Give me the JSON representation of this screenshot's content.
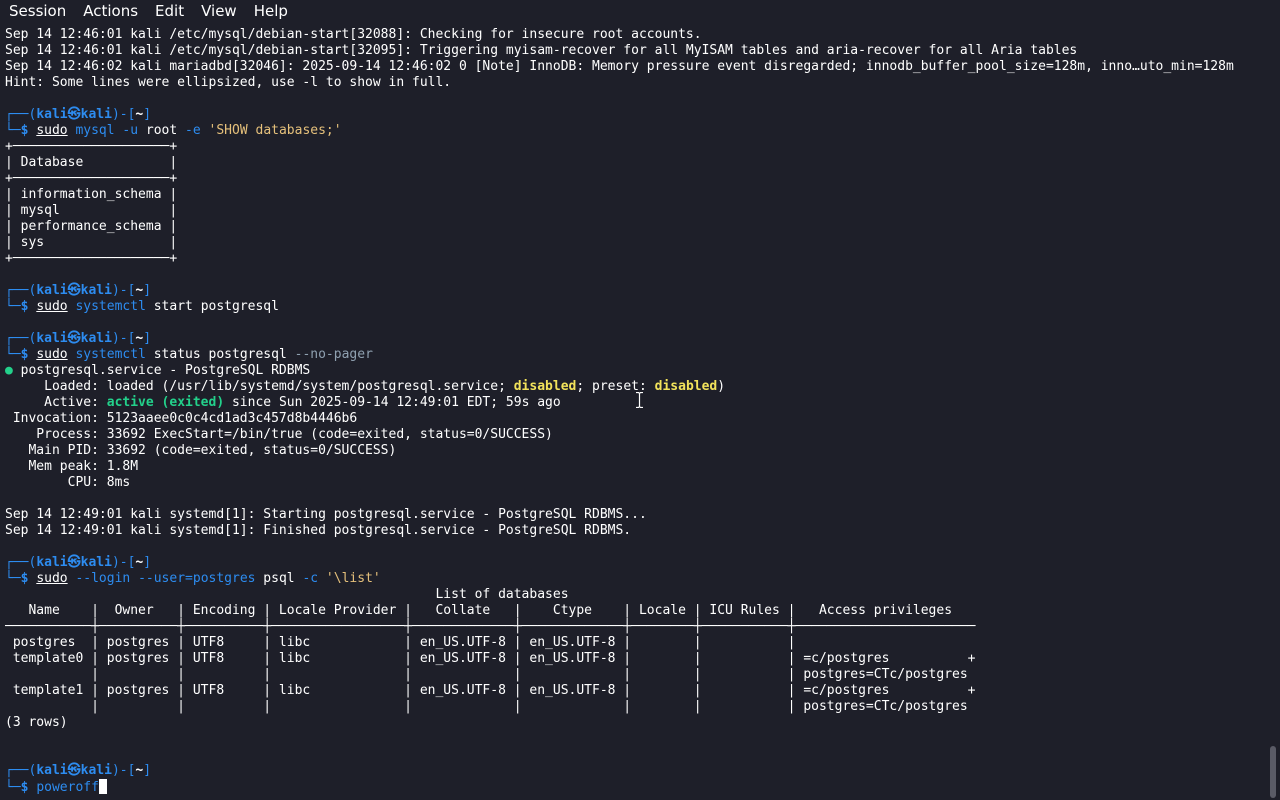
{
  "menubar": {
    "items": [
      "Session",
      "Actions",
      "Edit",
      "View",
      "Help"
    ]
  },
  "colors": {
    "background": "#1e1f29",
    "prompt_blue": "#2d8cf0",
    "ok_green": "#23d18b",
    "warn_yellow": "#f2e35b",
    "string_orange": "#e5c07b"
  },
  "terminal": {
    "lines": [
      [
        {
          "t": "Sep 14 12:46:01 kali /etc/mysql/debian-start[32088]: Checking for insecure root accounts.",
          "c": "default"
        }
      ],
      [
        {
          "t": "Sep 14 12:46:01 kali /etc/mysql/debian-start[32095]: Triggering myisam-recover for all MyISAM tables and aria-recover for all Aria tables",
          "c": "default"
        }
      ],
      [
        {
          "t": "Sep 14 12:46:02 kali mariadbd[32046]: 2025-09-14 12:46:02 0 [Note] InnoDB: Memory pressure event disregarded; innodb_buffer_pool_size=128m, inno…uto_min=128m",
          "c": "default"
        }
      ],
      [
        {
          "t": "Hint: Some lines were ellipsized, use -l to show in full.",
          "c": "default"
        }
      ],
      [
        {
          "t": "",
          "c": "default"
        }
      ],
      [
        {
          "t": "┌──(",
          "c": "prompt"
        },
        {
          "t": "kali㉿kali",
          "c": "user"
        },
        {
          "t": ")-[",
          "c": "prompt"
        },
        {
          "t": "~",
          "c": "path"
        },
        {
          "t": "]",
          "c": "prompt"
        }
      ],
      [
        {
          "t": "└─",
          "c": "prompt"
        },
        {
          "t": "$ ",
          "c": "dollar"
        },
        {
          "t": "sudo",
          "c": "cmd-sudo-plain"
        },
        {
          "t": " mysql",
          "c": "cmd"
        },
        {
          "t": " -u",
          "c": "flag"
        },
        {
          "t": " root",
          "c": "arg"
        },
        {
          "t": " -e",
          "c": "flag"
        },
        {
          "t": " 'SHOW databases;'",
          "c": "str"
        }
      ],
      [
        {
          "t": "+────────────────────+",
          "c": "default"
        }
      ],
      [
        {
          "t": "| Database           |",
          "c": "default"
        }
      ],
      [
        {
          "t": "+────────────────────+",
          "c": "default"
        }
      ],
      [
        {
          "t": "| information_schema |",
          "c": "default"
        }
      ],
      [
        {
          "t": "| mysql              |",
          "c": "default"
        }
      ],
      [
        {
          "t": "| performance_schema |",
          "c": "default"
        }
      ],
      [
        {
          "t": "| sys                |",
          "c": "default"
        }
      ],
      [
        {
          "t": "+────────────────────+",
          "c": "default"
        }
      ],
      [
        {
          "t": "",
          "c": "default"
        }
      ],
      [
        {
          "t": "┌──(",
          "c": "prompt"
        },
        {
          "t": "kali㉿kali",
          "c": "user"
        },
        {
          "t": ")-[",
          "c": "prompt"
        },
        {
          "t": "~",
          "c": "path"
        },
        {
          "t": "]",
          "c": "prompt"
        }
      ],
      [
        {
          "t": "└─",
          "c": "prompt"
        },
        {
          "t": "$ ",
          "c": "dollar"
        },
        {
          "t": "sudo",
          "c": "cmd-sudo-plain"
        },
        {
          "t": " systemctl",
          "c": "cmd"
        },
        {
          "t": " start postgresql",
          "c": "arg"
        }
      ],
      [
        {
          "t": "",
          "c": "default"
        }
      ],
      [
        {
          "t": "┌──(",
          "c": "prompt"
        },
        {
          "t": "kali㉿kali",
          "c": "user"
        },
        {
          "t": ")-[",
          "c": "prompt"
        },
        {
          "t": "~",
          "c": "path"
        },
        {
          "t": "]",
          "c": "prompt"
        }
      ],
      [
        {
          "t": "└─",
          "c": "prompt"
        },
        {
          "t": "$ ",
          "c": "dollar"
        },
        {
          "t": "sudo",
          "c": "cmd-sudo-plain"
        },
        {
          "t": " systemctl",
          "c": "cmd"
        },
        {
          "t": " status postgresql",
          "c": "arg"
        },
        {
          "t": " --no-pager",
          "c": "opt"
        }
      ],
      [
        {
          "t": "●",
          "c": "dot"
        },
        {
          "t": " postgresql.service - PostgreSQL RDBMS",
          "c": "default"
        }
      ],
      [
        {
          "t": "     Loaded: loaded (/usr/lib/systemd/system/postgresql.service; ",
          "c": "default"
        },
        {
          "t": "disabled",
          "c": "warn"
        },
        {
          "t": "; preset: ",
          "c": "default"
        },
        {
          "t": "disabled",
          "c": "warn"
        },
        {
          "t": ")",
          "c": "default"
        }
      ],
      [
        {
          "t": "     Active: ",
          "c": "default"
        },
        {
          "t": "active (exited)",
          "c": "ok"
        },
        {
          "t": " since Sun 2025-09-14 12:49:01 EDT; 59s ago",
          "c": "default"
        }
      ],
      [
        {
          "t": " Invocation: 5123aaee0c0c4cd1ad3c457d8b4446b6",
          "c": "default"
        }
      ],
      [
        {
          "t": "    Process: 33692 ExecStart=/bin/true (code=exited, status=0/SUCCESS)",
          "c": "default"
        }
      ],
      [
        {
          "t": "   Main PID: 33692 (code=exited, status=0/SUCCESS)",
          "c": "default"
        }
      ],
      [
        {
          "t": "   Mem peak: 1.8M",
          "c": "default"
        }
      ],
      [
        {
          "t": "        CPU: 8ms",
          "c": "default"
        }
      ],
      [
        {
          "t": "",
          "c": "default"
        }
      ],
      [
        {
          "t": "Sep 14 12:49:01 kali systemd[1]: Starting postgresql.service - PostgreSQL RDBMS...",
          "c": "default"
        }
      ],
      [
        {
          "t": "Sep 14 12:49:01 kali systemd[1]: Finished postgresql.service - PostgreSQL RDBMS.",
          "c": "default"
        }
      ],
      [
        {
          "t": "",
          "c": "default"
        }
      ],
      [
        {
          "t": "┌──(",
          "c": "prompt"
        },
        {
          "t": "kali㉿kali",
          "c": "user"
        },
        {
          "t": ")-[",
          "c": "prompt"
        },
        {
          "t": "~",
          "c": "path"
        },
        {
          "t": "]",
          "c": "prompt"
        }
      ],
      [
        {
          "t": "└─",
          "c": "prompt"
        },
        {
          "t": "$ ",
          "c": "dollar"
        },
        {
          "t": "sudo",
          "c": "cmd-sudo-plain"
        },
        {
          "t": " --login",
          "c": "flag"
        },
        {
          "t": " --user=postgres",
          "c": "flag"
        },
        {
          "t": " psql",
          "c": "arg"
        },
        {
          "t": " -c",
          "c": "flag"
        },
        {
          "t": " '\\list'",
          "c": "str"
        }
      ],
      [
        {
          "t": "                                                       List of databases",
          "c": "default"
        }
      ],
      [
        {
          "t": "   Name    |  Owner   | Encoding | Locale Provider |   Collate   |    Ctype    | Locale | ICU Rules |   Access privileges",
          "c": "default"
        }
      ],
      [
        {
          "t": "───────────┼──────────┼──────────┼─────────────────┼─────────────┼─────────────┼────────┼───────────┼───────────────────────",
          "c": "default"
        }
      ],
      [
        {
          "t": " postgres  | postgres | UTF8     | libc            | en_US.UTF-8 | en_US.UTF-8 |        |           |",
          "c": "default"
        }
      ],
      [
        {
          "t": " template0 | postgres | UTF8     | libc            | en_US.UTF-8 | en_US.UTF-8 |        |           | =c/postgres          +",
          "c": "default"
        }
      ],
      [
        {
          "t": "           |          |          |                 |             |             |        |           | postgres=CTc/postgres",
          "c": "default"
        }
      ],
      [
        {
          "t": " template1 | postgres | UTF8     | libc            | en_US.UTF-8 | en_US.UTF-8 |        |           | =c/postgres          +",
          "c": "default"
        }
      ],
      [
        {
          "t": "           |          |          |                 |             |             |        |           | postgres=CTc/postgres",
          "c": "default"
        }
      ],
      [
        {
          "t": "(3 rows)",
          "c": "default"
        }
      ],
      [
        {
          "t": "",
          "c": "default"
        }
      ],
      [
        {
          "t": "",
          "c": "default"
        }
      ],
      [
        {
          "t": "┌──(",
          "c": "prompt"
        },
        {
          "t": "kali㉿kali",
          "c": "user"
        },
        {
          "t": ")-[",
          "c": "prompt"
        },
        {
          "t": "~",
          "c": "path"
        },
        {
          "t": "]",
          "c": "prompt"
        }
      ],
      [
        {
          "t": "└─",
          "c": "prompt"
        },
        {
          "t": "$ ",
          "c": "dollar"
        },
        {
          "t": "poweroff",
          "c": "cmd"
        },
        {
          "t": "",
          "c": "cursor"
        }
      ]
    ]
  }
}
